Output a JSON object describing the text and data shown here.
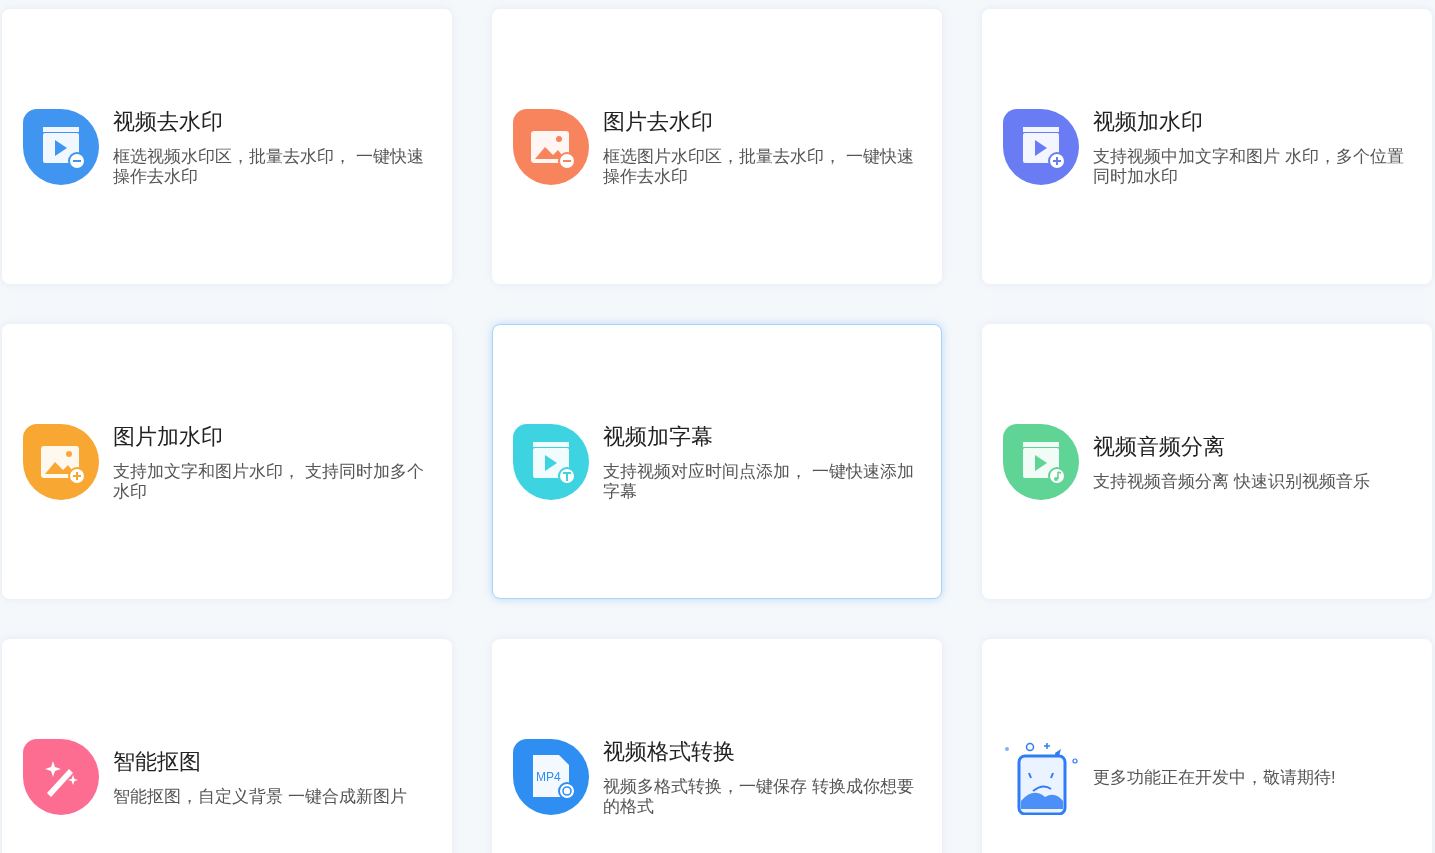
{
  "cards": [
    {
      "kind": "video-minus",
      "color": "#3f95f0",
      "title": "视频去水印",
      "description": "框选视频水印区，批量去水印， 一键快速操作去水印",
      "selected": false
    },
    {
      "kind": "image-minus",
      "color": "#f7845c",
      "title": "图片去水印",
      "description": "框选图片水印区，批量去水印， 一键快速操作去水印",
      "selected": false
    },
    {
      "kind": "video-plus",
      "color": "#6a7cf4",
      "title": "视频加水印",
      "description": "支持视频中加文字和图片 水印，多个位置同时加水印",
      "selected": false
    },
    {
      "kind": "image-plus",
      "color": "#f8a832",
      "title": "图片加水印",
      "description": "支持加文字和图片水印， 支持同时加多个水印",
      "selected": false
    },
    {
      "kind": "video-text",
      "color": "#3dd3e0",
      "title": "视频加字幕",
      "description": "支持视频对应时间点添加， 一键快速添加字幕",
      "selected": true
    },
    {
      "kind": "video-music",
      "color": "#5fd495",
      "title": "视频音频分离",
      "description": "支持视频音频分离 快速识别视频音乐",
      "selected": false
    },
    {
      "kind": "wand",
      "color": "#fd6d92",
      "title": "智能抠图",
      "description": "智能抠图，自定义背景 一键合成新图片",
      "selected": false
    },
    {
      "kind": "file",
      "color": "#2f8ef2",
      "file_label": "MP4",
      "title": "视频格式转换",
      "description": "视频多格式转换，一键保存 转换成你想要的格式",
      "selected": false
    },
    {
      "kind": "mascot",
      "color": "#2f7df6",
      "description": "更多功能正在开发中，敬请期待!",
      "selected": false
    }
  ]
}
